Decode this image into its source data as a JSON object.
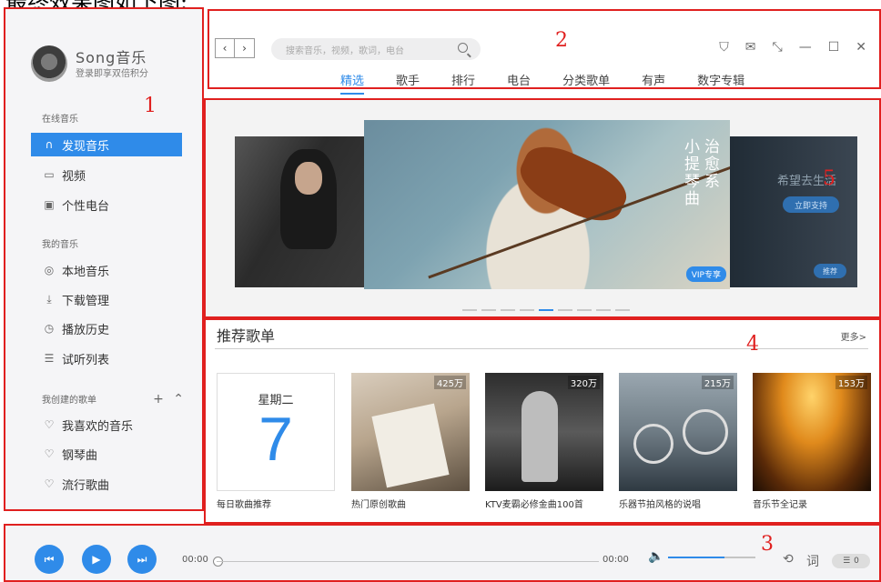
{
  "caption": "最终效果图如下图:",
  "region_numbers": [
    "1",
    "2",
    "3",
    "4",
    "5"
  ],
  "sidebar": {
    "app_name": "Song音乐",
    "login_hint": "登录即享双倍积分",
    "section_online": "在线音乐",
    "online_items": [
      {
        "label": "发现音乐",
        "icon": "headphones-icon"
      },
      {
        "label": "视频",
        "icon": "video-icon"
      },
      {
        "label": "个性电台",
        "icon": "radio-icon"
      }
    ],
    "section_mine": "我的音乐",
    "mine_items": [
      {
        "label": "本地音乐",
        "icon": "music-disc-icon"
      },
      {
        "label": "下载管理",
        "icon": "download-icon"
      },
      {
        "label": "播放历史",
        "icon": "clock-icon"
      },
      {
        "label": "试听列表",
        "icon": "list-icon"
      }
    ],
    "section_created": "我创建的歌单",
    "created_items": [
      {
        "label": "我喜欢的音乐",
        "icon": "heart-icon"
      },
      {
        "label": "钢琴曲",
        "icon": "heart-icon"
      },
      {
        "label": "流行歌曲",
        "icon": "heart-icon"
      }
    ]
  },
  "header": {
    "search_placeholder": "搜索音乐，视频，歌词，电台",
    "tabs": [
      "精选",
      "歌手",
      "排行",
      "电台",
      "分类歌单",
      "有声",
      "数字专辑"
    ],
    "active_tab": "精选"
  },
  "banner": {
    "right_title": "希望去生活",
    "right_button": "立即支持",
    "right_small_button": "推荐",
    "main_text_col1": "小提琴曲",
    "main_text_col2": "治愈系",
    "vip_badge": "VIP专享",
    "dot_count": 9,
    "active_dot": 5
  },
  "recommend": {
    "title": "推荐歌单",
    "more": "更多>",
    "daily": {
      "weekday": "星期二",
      "day": "7",
      "label": "每日歌曲推荐"
    },
    "playlists": [
      {
        "count": "425万",
        "label": "热门原创歌曲"
      },
      {
        "count": "320万",
        "label": "KTV麦霸必修金曲100首"
      },
      {
        "count": "215万",
        "label": "乐器节拍风格的说唱"
      },
      {
        "count": "153万",
        "label": "音乐节全记录"
      }
    ]
  },
  "player": {
    "time_current": "00:00",
    "time_total": "00:00",
    "lyric_label": "词",
    "playlist_count": "0",
    "volume": 0.65
  }
}
